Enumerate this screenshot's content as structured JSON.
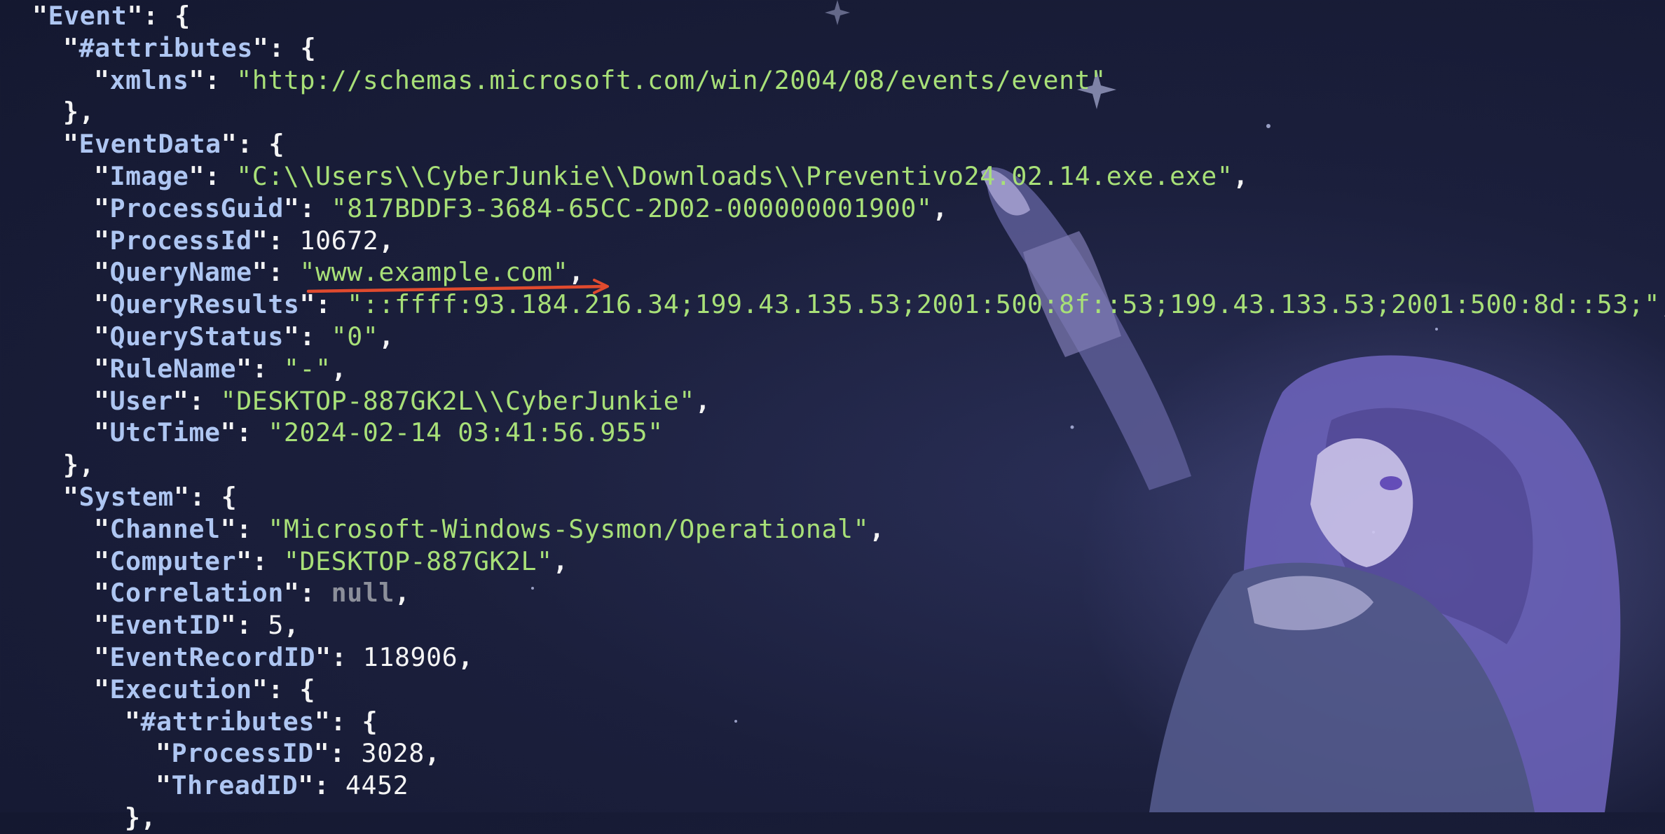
{
  "json_viewer": {
    "lines": [
      {
        "indent": 1,
        "key": "Event",
        "open": "{"
      },
      {
        "indent": 2,
        "key": "#attributes",
        "open": "{"
      },
      {
        "indent": 3,
        "key": "xmlns",
        "value": "\"http://schemas.microsoft.com/win/2004/08/events/event\"",
        "type": "string"
      },
      {
        "indent": 2,
        "close": "},"
      },
      {
        "indent": 2,
        "key": "EventData",
        "open": "{"
      },
      {
        "indent": 3,
        "key": "Image",
        "value": "\"C:\\\\Users\\\\CyberJunkie\\\\Downloads\\\\Preventivo24.02.14.exe.exe\"",
        "type": "string",
        "comma": true
      },
      {
        "indent": 3,
        "key": "ProcessGuid",
        "value": "\"817BDDF3-3684-65CC-2D02-000000001900\"",
        "type": "string",
        "comma": true
      },
      {
        "indent": 3,
        "key": "ProcessId",
        "value": "10672",
        "type": "number",
        "comma": true
      },
      {
        "indent": 3,
        "key": "QueryName",
        "value": "\"www.example.com\"",
        "type": "string",
        "comma": true
      },
      {
        "indent": 3,
        "key": "QueryResults",
        "value": "\"::ffff:93.184.216.34;199.43.135.53;2001:500:8f::53;199.43.133.53;2001:500:8d::53;\"",
        "type": "string",
        "comma": true
      },
      {
        "indent": 3,
        "key": "QueryStatus",
        "value": "\"0\"",
        "type": "string",
        "comma": true
      },
      {
        "indent": 3,
        "key": "RuleName",
        "value": "\"-\"",
        "type": "string",
        "comma": true
      },
      {
        "indent": 3,
        "key": "User",
        "value": "\"DESKTOP-887GK2L\\\\CyberJunkie\"",
        "type": "string",
        "comma": true
      },
      {
        "indent": 3,
        "key": "UtcTime",
        "value": "\"2024-02-14 03:41:56.955\"",
        "type": "string"
      },
      {
        "indent": 2,
        "close": "},"
      },
      {
        "indent": 2,
        "key": "System",
        "open": "{"
      },
      {
        "indent": 3,
        "key": "Channel",
        "value": "\"Microsoft-Windows-Sysmon/Operational\"",
        "type": "string",
        "comma": true
      },
      {
        "indent": 3,
        "key": "Computer",
        "value": "\"DESKTOP-887GK2L\"",
        "type": "string",
        "comma": true
      },
      {
        "indent": 3,
        "key": "Correlation",
        "value": "null",
        "type": "null",
        "comma": true
      },
      {
        "indent": 3,
        "key": "EventID",
        "value": "5",
        "type": "number",
        "comma": true
      },
      {
        "indent": 3,
        "key": "EventRecordID",
        "value": "118906",
        "type": "number",
        "comma": true
      },
      {
        "indent": 3,
        "key": "Execution",
        "open": "{"
      },
      {
        "indent": 4,
        "key": "#attributes",
        "open": "{"
      },
      {
        "indent": 5,
        "key": "ProcessID",
        "value": "3028",
        "type": "number",
        "comma": true
      },
      {
        "indent": 5,
        "key": "ThreadID",
        "value": "4452",
        "type": "number"
      },
      {
        "indent": 4,
        "close": "},"
      }
    ],
    "highlighted_key": "QueryName"
  },
  "colors": {
    "background": "#1b1f3c",
    "key": "#aec6f2",
    "string": "#a8e078",
    "number": "#f4f4f4",
    "null": "#8c8f9a",
    "annotation": "#e04a2e"
  }
}
